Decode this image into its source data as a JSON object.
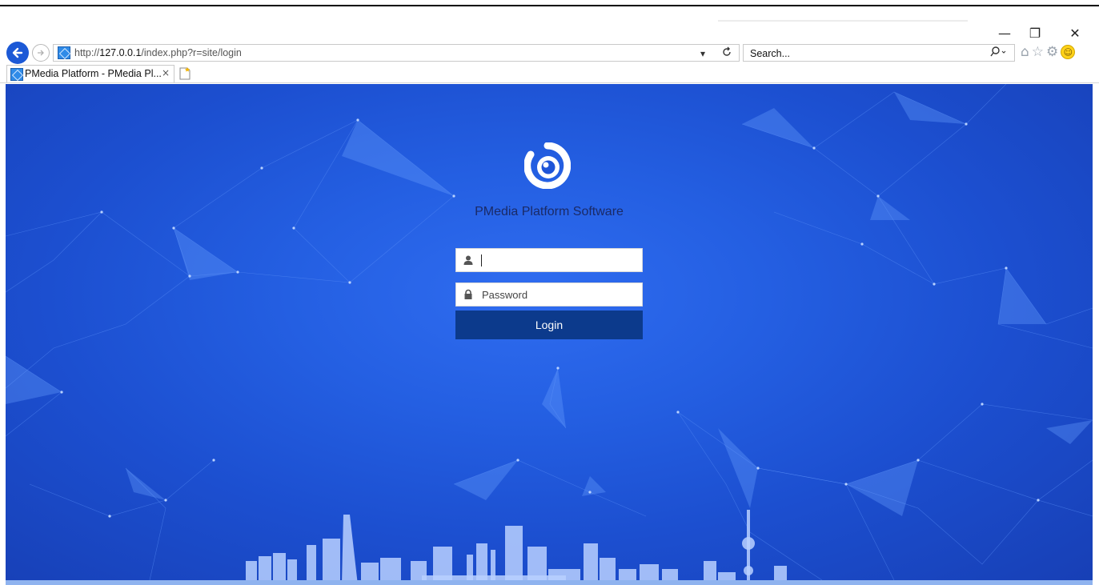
{
  "browser": {
    "window_controls": {
      "minimize": "—",
      "restore": "❐",
      "close": "✕"
    },
    "address": {
      "url_prefix": "http://",
      "url_host": "127.0.0.1",
      "url_path": "/index.php?r=site/login"
    },
    "search": {
      "placeholder": "Search..."
    },
    "tab": {
      "title": "PMedia Platform - PMedia Pl...",
      "close": "×"
    },
    "icons": [
      "back-arrow-icon",
      "forward-arrow-icon",
      "refresh-icon",
      "search-icon",
      "home-icon",
      "star-icon",
      "gear-icon",
      "smiley-icon"
    ]
  },
  "login": {
    "app_title": "PMedia Platform Software",
    "username": {
      "placeholder": "",
      "value": ""
    },
    "password": {
      "placeholder": "Password",
      "value": ""
    },
    "submit_label": "Login"
  },
  "colors": {
    "background": "#1f55d8",
    "button": "#0c3a8c",
    "title": "#1a2a66"
  }
}
